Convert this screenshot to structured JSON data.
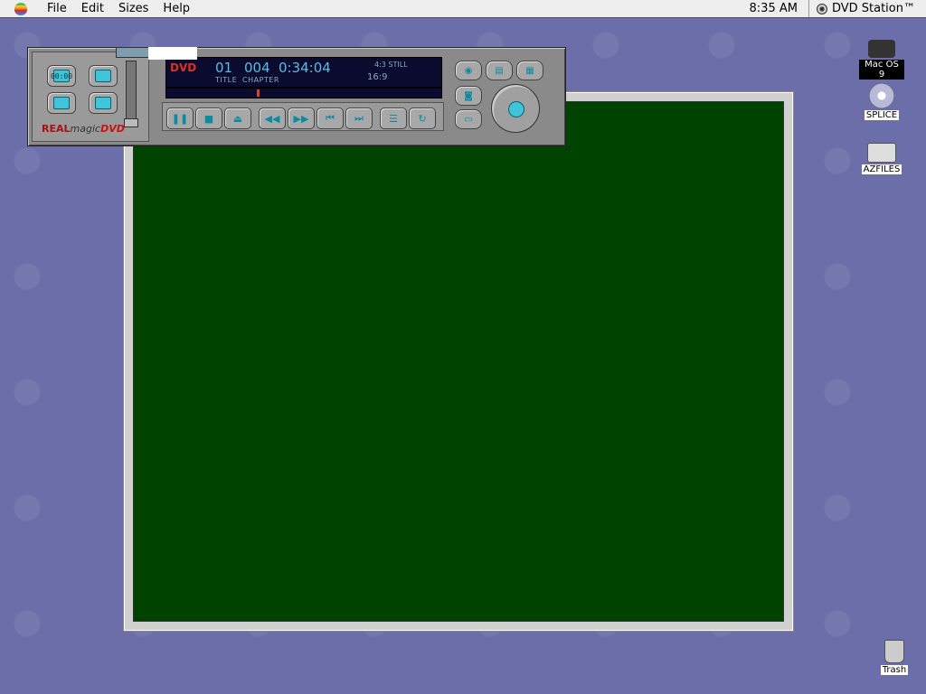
{
  "menubar": {
    "items": [
      "File",
      "Edit",
      "Sizes",
      "Help"
    ],
    "clock": "8:35 AM",
    "app_name": "DVD Station™"
  },
  "player": {
    "time_btn": "00:00",
    "brand_real": "REAL",
    "brand_magic": "magic",
    "brand_dvd": "DVD",
    "lcd": {
      "dvd": "DVD",
      "title": "01",
      "chapter": "004",
      "time": "0:34:04",
      "title_label": "TITLE",
      "chapter_label": "CHAPTER",
      "aspect": "4:3 STILL",
      "wide": "16:9"
    }
  },
  "desktop": {
    "icons": [
      {
        "label": "Mac OS 9"
      },
      {
        "label": "SPLICE"
      },
      {
        "label": "AZFILES"
      },
      {
        "label": "Trash"
      }
    ]
  },
  "colors": {
    "desktop": "#6b6ea8",
    "video_bg": "#004200",
    "lcd_bg": "#0b0b30",
    "accent": "#3fc4d8"
  }
}
